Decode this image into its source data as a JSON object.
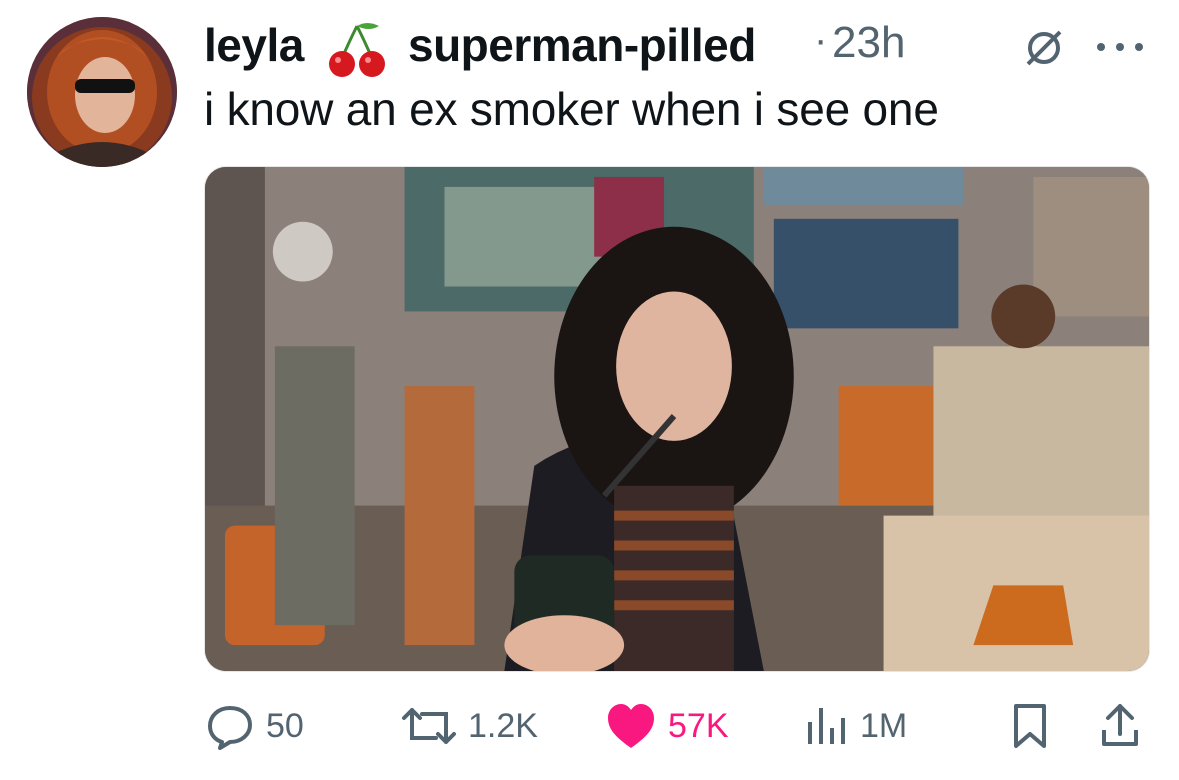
{
  "author": {
    "display_name": "leyla",
    "emoji": "cherry-icon",
    "username": "superman-pilled",
    "separator": "·",
    "timestamp": "23h"
  },
  "tweet": {
    "text": "i know an ex smoker when i see one"
  },
  "actions": {
    "replies": "50",
    "reposts": "1.2K",
    "likes": "57K",
    "views": "1M"
  },
  "colors": {
    "like_active": "#f91880",
    "secondary_text": "#536471"
  }
}
